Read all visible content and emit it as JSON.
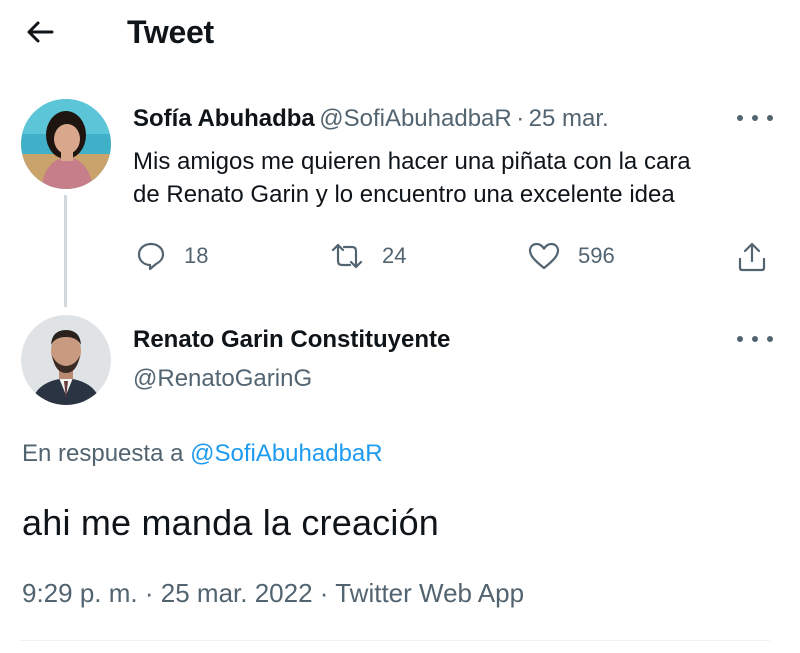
{
  "header": {
    "title": "Tweet"
  },
  "parent_tweet": {
    "name": "Sofía Abuhadba",
    "handle": "@SofiAbuhadbaR",
    "separator": "·",
    "date": "25 mar.",
    "text_line1": "Mis amigos me quieren hacer una piñata con la cara",
    "text_line2": "de Renato Garin y lo encuentro una excelente idea",
    "replies": "18",
    "retweets": "24",
    "likes": "596"
  },
  "main_tweet": {
    "name": "Renato Garin Constituyente",
    "handle": "@RenatoGarinG",
    "reply_prefix": "En respuesta a",
    "reply_handle": "@SofiAbuhadbaR",
    "text": "ahi me manda la creación",
    "time": "9:29 p. m.",
    "date": "25 mar. 2022",
    "source": "Twitter Web App",
    "separator": "·"
  },
  "colors": {
    "link": "#1d9bf0",
    "secondary_text": "#536471",
    "primary_text": "#0f1419"
  }
}
